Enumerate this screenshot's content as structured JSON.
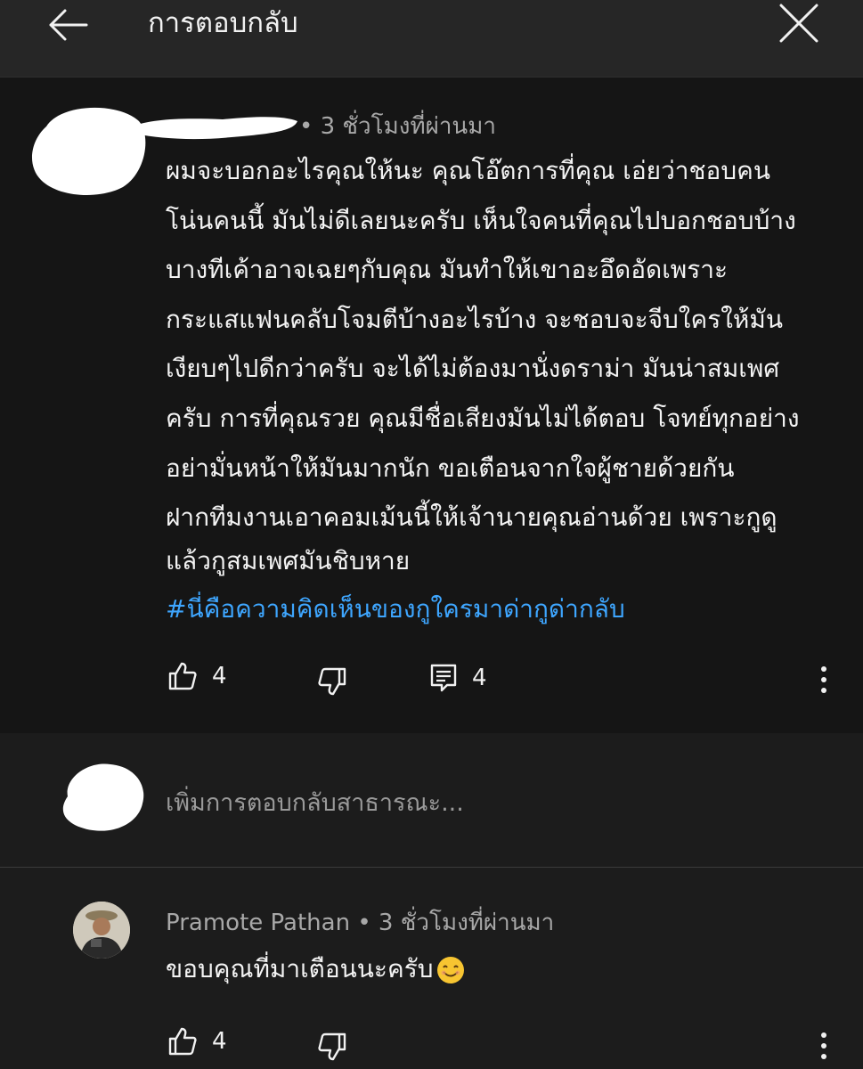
{
  "header": {
    "title": "การตอบกลับ",
    "back_icon": "arrow-left-icon",
    "close_icon": "close-icon"
  },
  "comment": {
    "meta": "• 3 ชั่วโมงที่ผ่านมา",
    "lines": [
      "ผมจะบอกอะไรคุณให้นะ คุณโอ๊ตการที่คุณ เอ่ยว่าชอบคน",
      "โน่นคนนี้ มันไม่ดีเลยนะครับ เห็นใจคนที่คุณไปบอกชอบบ้าง",
      "บางทีเค้าอาจเฉยๆกับคุณ มันทำให้เขาอะอึดอัดเพราะ",
      "กระแสแฟนคลับโจมตีบ้างอะไรบ้าง  จะชอบจะจีบใครให้มัน",
      "เงียบๆไปดีกว่าครับ จะได้ไม่ต้องมานั่งดราม่า มันน่าสมเพศ",
      "ครับ การที่คุณรวย คุณมีชื่อเสียงมันไม่ได้ตอบ โจทย์ทุกอย่าง",
      "อย่ามั่นหน้าให้มันมากนัก ขอเตือนจากใจผู้ชายด้วยกัน",
      "ฝากทีมงานเอาคอมเม้นนี้ให้เจ้านายคุณอ่านด้วย เพราะกูดู",
      "แล้วกูสมเพศมันชิบหาย"
    ],
    "hashtag": "#นี่คือความคิดเห็นของกูใครมาด่ากูด่ากลับ",
    "likes": "4",
    "replies": "4"
  },
  "reply_box": {
    "placeholder": "เพิ่มการตอบกลับสาธารณะ..."
  },
  "reply": {
    "author": "Pramote Pathan",
    "meta": "• 3 ชั่วโมงที่ผ่านมา",
    "text": "ขอบคุณที่มาเตือนนะครับ",
    "emoji_icon": "smiling-face-emoji-icon",
    "likes": "4"
  },
  "colors": {
    "background": "#151515",
    "header": "#262626",
    "hashtag": "#3ea6ff",
    "meta_text": "#a8a8a8"
  }
}
